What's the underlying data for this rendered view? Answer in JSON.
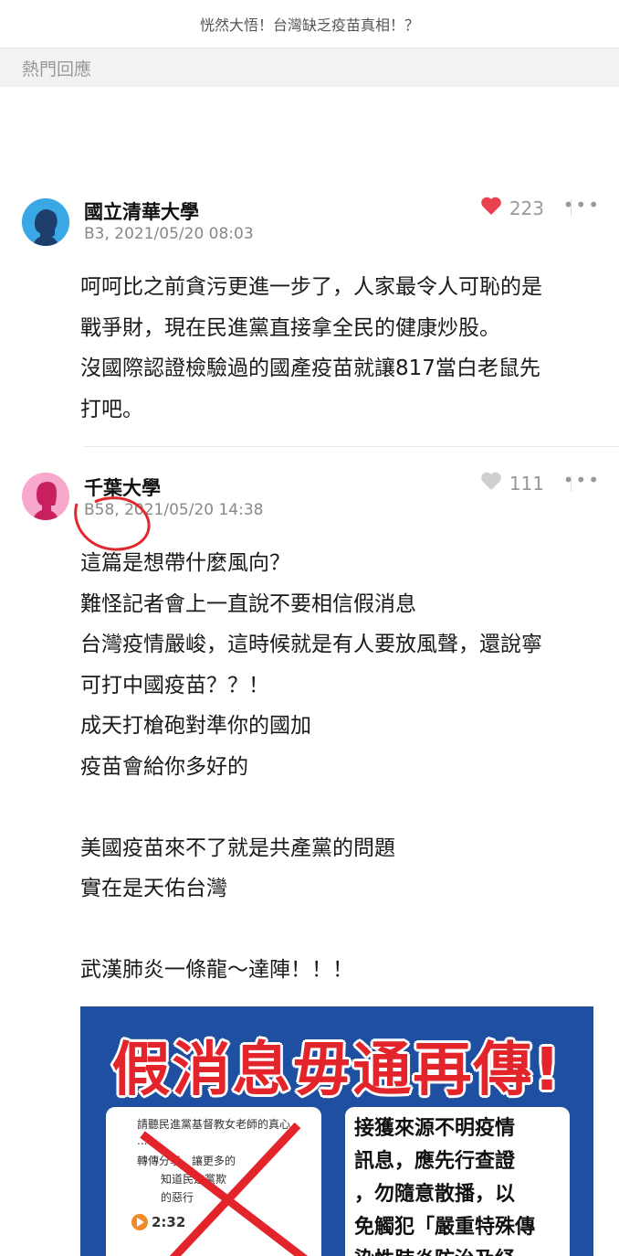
{
  "header": {
    "title": "恍然大悟！台灣缺乏疫苗真相！？"
  },
  "section": {
    "label": "熱門回應"
  },
  "posts": [
    {
      "author": "國立清華大學",
      "meta": "B3, 2021/05/20 08:03",
      "likes": "223",
      "liked": true,
      "lines": [
        "呵呵比之前貪污更進一步了，人家最令人可恥的是",
        "戰爭財，現在民進黨直接拿全民的健康炒股。",
        "沒國際認證檢驗過的國產疫苗就讓817當白老鼠先",
        "打吧。"
      ]
    },
    {
      "author": "千葉大學",
      "meta": "B58, 2021/05/20 14:38",
      "likes": "111",
      "liked": false,
      "lines": [
        "這篇是想帶什麼風向？",
        "難怪記者會上一直說不要相信假消息",
        "台灣疫情嚴峻，這時候就是有人要放風聲，還說寧",
        "可打中國疫苗？？！",
        "成天打槍砲對準你的國加",
        "疫苗會給你多好的",
        "",
        "美國疫苗來不了就是共產黨的問題",
        "實在是天佑台灣",
        "",
        "武漢肺炎一條龍～達陣！！！"
      ]
    }
  ],
  "banner": {
    "title": "假消息毋通再傳!",
    "card_lines": [
      "請聽民進黨基督教女老師的真心",
      "......",
      "轉傳分享，讓更多的",
      "知道民進黨欺",
      "的惡行"
    ],
    "audio_time": "2:32",
    "notice_lines": [
      "接獲來源不明疫情",
      "訊息，應先行查證",
      "，勿隨意散播，以",
      "免觸犯「嚴重特殊傳",
      "染性肺炎防治及紓"
    ]
  },
  "colors": {
    "heart_active": "#e8424f",
    "heart_inactive": "#cfcfcf",
    "annotation_circle": "#e0282c",
    "banner_bg": "#1f4fa0"
  }
}
